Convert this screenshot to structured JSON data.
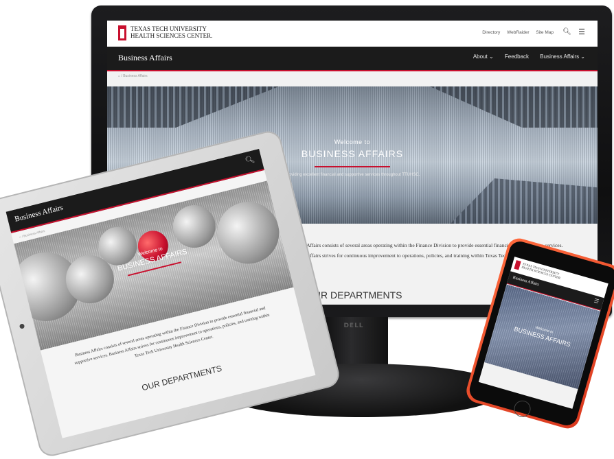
{
  "monitor": {
    "brand": "DELL",
    "site": {
      "university": [
        "TEXAS TECH UNIVERSITY",
        "HEALTH SCIENCES CENTER."
      ],
      "top_links": [
        "Directory",
        "WebRaider",
        "Site Map"
      ],
      "site_title": "Business Affairs",
      "nav": [
        "About ⌄",
        "Feedback",
        "Business Affairs ⌄"
      ],
      "breadcrumb": "⌂  /  Business Affairs",
      "hero": {
        "welcome": "Welcome to",
        "title": "BUSINESS AFFAIRS",
        "tagline": "Providing excellent financial and supportive services throughout TTUHSC."
      },
      "intro": "Business Affairs consists of several areas operating within the Finance Division to provide essential financial and supportive services. Business Affairs strives for continuous improvement to operations, policies, and training within Texas Tech University Health Sciences Center.",
      "departments_heading": "OUR DEPARTMENTS"
    }
  },
  "tablet": {
    "site_title": "Business Affairs",
    "breadcrumb": "⌂  /  Business Affairs",
    "hero": {
      "welcome": "Welcome to",
      "title": "BUSINESS AFFAIRS"
    },
    "intro": "Business Affairs consists of several areas operating within the Finance Division to provide essential financial and supportive services. Business Affairs strives for continuous improvement to operations, policies, and training within Texas Tech University Health Sciences Center.",
    "departments_heading": "OUR DEPARTMENTS"
  },
  "phone": {
    "university": [
      "TEXAS TECH UNIVERSITY",
      "HEALTH SCIENCES CENTER."
    ],
    "site_title": "Business Affairs",
    "hero": {
      "welcome": "Welcome to",
      "title": "BUSINESS AFFAIRS"
    }
  },
  "colors": {
    "accent_red": "#c8102e",
    "nav_dark": "#1b1b1b",
    "phone_case": "#e6482a"
  },
  "icons": [
    "double-t-logo-icon",
    "search-icon",
    "hamburger-menu-icon",
    "home-icon",
    "chevron-down-icon"
  ]
}
